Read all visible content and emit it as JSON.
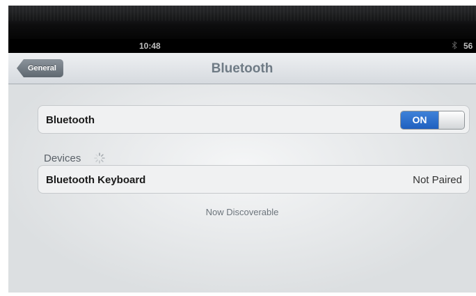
{
  "status_bar": {
    "time": "10:48",
    "bluetooth_icon": "bluetooth-icon",
    "battery": "56"
  },
  "nav": {
    "back_label": "General",
    "title": "Bluetooth"
  },
  "bluetooth_row": {
    "label": "Bluetooth",
    "toggle_label": "ON",
    "toggle_on": true
  },
  "devices": {
    "header": "Devices",
    "spinner_icon": "activity-spinner-icon",
    "items": [
      {
        "name": "Bluetooth Keyboard",
        "status": "Not Paired"
      }
    ]
  },
  "footer": {
    "note": "Now Discoverable"
  },
  "colors": {
    "toggle_on": "#2c6fcf",
    "nav_title": "#6f7b85",
    "back_button": "#6b747c"
  }
}
